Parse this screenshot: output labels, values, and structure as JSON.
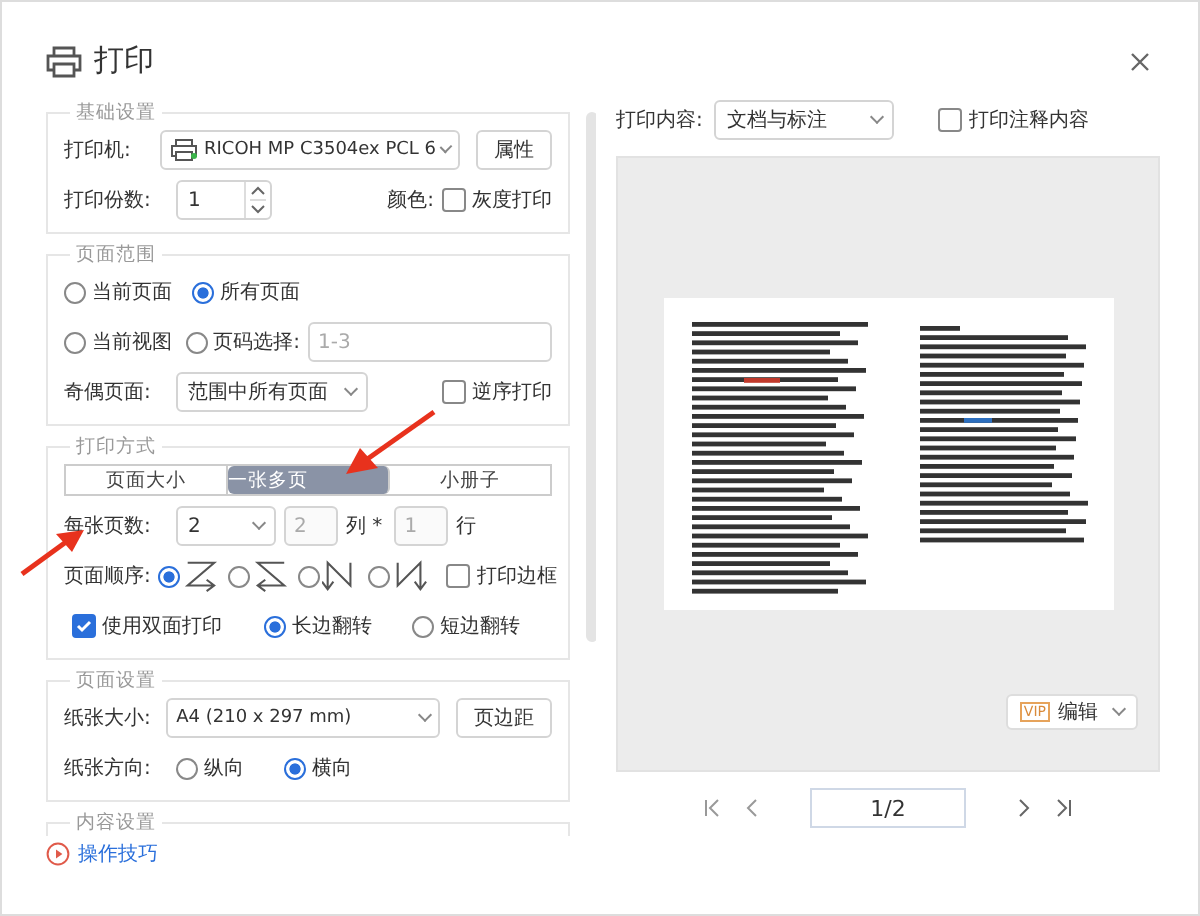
{
  "dialog": {
    "title": "打印"
  },
  "basic": {
    "legend": "基础设置",
    "printer_label": "打印机:",
    "printer": "RICOH MP C3504ex PCL 6",
    "properties_button": "属性",
    "copies_label": "打印份数:",
    "copies": "1",
    "color_label": "颜色:",
    "grayscale": {
      "label": "灰度打印",
      "checked": false
    }
  },
  "range": {
    "legend": "页面范围",
    "options": [
      {
        "label": "当前页面",
        "selected": false
      },
      {
        "label": "所有页面",
        "selected": true
      },
      {
        "label": "当前视图",
        "selected": false
      },
      {
        "label": "页码选择:",
        "selected": false
      }
    ],
    "page_placeholder": "1-3",
    "odd_even_label": "奇偶页面:",
    "odd_even": "范围中所有页面",
    "reverse": {
      "label": "逆序打印",
      "checked": false
    }
  },
  "mode": {
    "legend": "打印方式",
    "tabs": [
      {
        "label": "页面大小",
        "selected": false
      },
      {
        "label": "一张多页",
        "selected": true
      },
      {
        "label": "小册子",
        "selected": false
      }
    ],
    "pages_per_sheet_label": "每张页数:",
    "pages_per_sheet": "2",
    "grid_disabled": true,
    "columns": "2",
    "columns_label": "列 *",
    "rows": "1",
    "rows_label": "行",
    "order_label": "页面顺序:",
    "orders": [
      {
        "kind": "z",
        "selected": true
      },
      {
        "kind": "z_reverse",
        "selected": false
      },
      {
        "kind": "n",
        "selected": false
      },
      {
        "kind": "n_reverse",
        "selected": false
      }
    ],
    "border": {
      "label": "打印边框",
      "checked": false
    },
    "duplex": {
      "label": "使用双面打印",
      "checked": true
    },
    "flip": [
      {
        "label": "长边翻转",
        "selected": true
      },
      {
        "label": "短边翻转",
        "selected": false
      }
    ]
  },
  "page_setup": {
    "legend": "页面设置",
    "paper_label": "纸张大小:",
    "paper": "A4 (210 x 297 mm)",
    "margins_button": "页边距",
    "orientation_label": "纸张方向:",
    "orientations": [
      {
        "label": "纵向",
        "selected": false
      },
      {
        "label": "横向",
        "selected": true
      }
    ]
  },
  "content_legend": "内容设置",
  "tips_link": "操作技巧",
  "preview": {
    "content_label": "打印内容:",
    "content": "文档与标注",
    "annotations": {
      "label": "打印注释内容",
      "checked": false
    },
    "edit_badge": "VIP",
    "edit_button": "编辑",
    "page": "1/2"
  }
}
